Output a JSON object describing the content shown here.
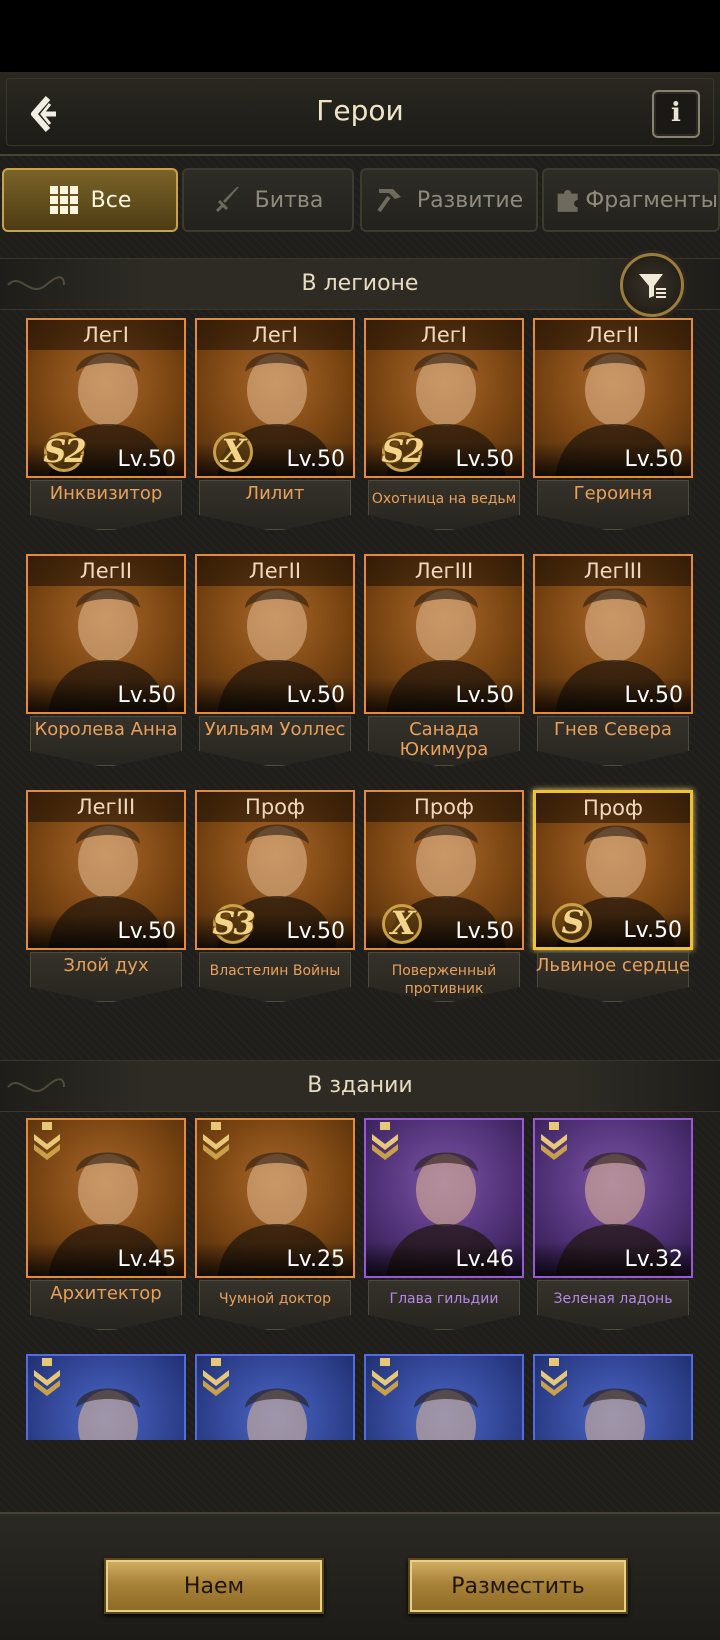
{
  "header": {
    "title": "Герои",
    "back_icon": "back-arrow-icon",
    "info_label": "i"
  },
  "tabs": [
    {
      "label": "Все",
      "icon": "grid-icon",
      "active": true
    },
    {
      "label": "Битва",
      "icon": "sword-icon",
      "active": false
    },
    {
      "label": "Развитие",
      "icon": "hammer-icon",
      "active": false
    },
    {
      "label": "Фрагменты",
      "icon": "puzzle-icon",
      "active": false
    }
  ],
  "sections": {
    "legion": "В легионе",
    "building": "В здании"
  },
  "legion_heroes": [
    {
      "rank": "ЛегI",
      "level": "Lv.50",
      "badge": "S2",
      "name": "Инквизитор"
    },
    {
      "rank": "ЛегI",
      "level": "Lv.50",
      "badge": "X",
      "name": "Лилит"
    },
    {
      "rank": "ЛегI",
      "level": "Lv.50",
      "badge": "S2",
      "name": "Охотница на ведьм"
    },
    {
      "rank": "ЛегII",
      "level": "Lv.50",
      "badge": "",
      "name": "Героиня"
    },
    {
      "rank": "ЛегII",
      "level": "Lv.50",
      "badge": "",
      "name": "Королева Анна"
    },
    {
      "rank": "ЛегII",
      "level": "Lv.50",
      "badge": "",
      "name": "Уильям Уоллес"
    },
    {
      "rank": "ЛегIII",
      "level": "Lv.50",
      "badge": "",
      "name": "Санада Юкимура"
    },
    {
      "rank": "ЛегIII",
      "level": "Lv.50",
      "badge": "",
      "name": "Гнев Севера"
    },
    {
      "rank": "ЛегIII",
      "level": "Lv.50",
      "badge": "",
      "name": "Злой дух"
    },
    {
      "rank": "Проф",
      "level": "Lv.50",
      "badge": "S3",
      "name": "Властелин Войны"
    },
    {
      "rank": "Проф",
      "level": "Lv.50",
      "badge": "X",
      "name": "Поверженный противник"
    },
    {
      "rank": "Проф",
      "level": "Lv.50",
      "badge": "S",
      "name": "Львиное сердце"
    }
  ],
  "building_heroes": [
    {
      "level": "Lv.45",
      "name": "Архитектор",
      "color": "orange"
    },
    {
      "level": "Lv.25",
      "name": "Чумной доктор",
      "color": "orange"
    },
    {
      "level": "Lv.46",
      "name": "Глава гильдии",
      "color": "purple"
    },
    {
      "level": "Lv.32",
      "name": "Зеленая ладонь",
      "color": "purple"
    }
  ],
  "buttons": {
    "hire": "Наем",
    "place": "Разместить"
  },
  "colors": {
    "legendary_border": "#e48a3c",
    "epic_border": "#9a57d6",
    "rare_border": "#4f6ce0",
    "gold": "#c9a24a"
  }
}
